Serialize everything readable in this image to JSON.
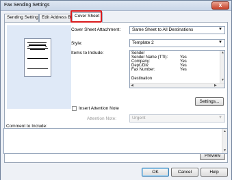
{
  "window": {
    "title": "Fax Sending Settings",
    "close_glyph": "x"
  },
  "tabs": [
    {
      "label": "Sending Settings"
    },
    {
      "label": "Edit Address Boo"
    },
    {
      "label": "Cover Sheet"
    }
  ],
  "cover_sheet_attachment": {
    "label": "Cover Sheet Attachment:",
    "value": "Same Sheet to All Destinations"
  },
  "style": {
    "label": "Style:",
    "value": "Template 2"
  },
  "items_to_include": {
    "label": "Items to Include:",
    "rows": [
      {
        "name": "Sender",
        "value": ""
      },
      {
        "name": "Sender Name (TTI):",
        "value": "Yes"
      },
      {
        "name": "Company:",
        "value": "Yes"
      },
      {
        "name": "Dept./Div:",
        "value": "Yes"
      },
      {
        "name": "Fax Number:",
        "value": "Yes"
      },
      {
        "name": "",
        "value": ""
      },
      {
        "name": "Destination",
        "value": ""
      }
    ]
  },
  "settings_button": "Settings...",
  "insert_attention_note": {
    "label": "Insert Attention Note",
    "checked": false
  },
  "attention_note": {
    "label": "Attention Note:",
    "value": "Urgent"
  },
  "comment_to_include": {
    "label": "Comment to Include:"
  },
  "preview_button": "Preview",
  "footer": {
    "ok": "OK",
    "cancel": "Cancel",
    "help": "Help"
  },
  "icons": {
    "dropdown": "▼",
    "scroll_up": "▲",
    "scroll_down": "▼",
    "scroll_left": "◀",
    "scroll_right": "▶"
  },
  "colors": {
    "highlight": "#d9191c",
    "preview_bg": "#dfe9f7"
  }
}
